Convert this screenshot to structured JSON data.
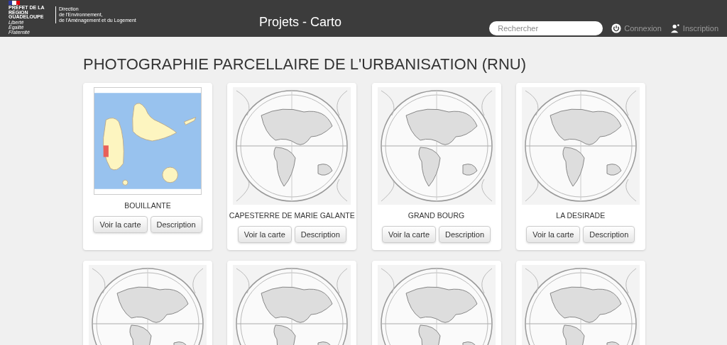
{
  "header": {
    "logo": {
      "name": "PRÉFET DE LA RÉGION GUADELOUPE",
      "motto": "Liberté Égalité Fraternité",
      "department": [
        "Direction",
        "de l'Environnement,",
        "de l'Aménagement et du Logement"
      ]
    },
    "title": "Projets - Carto",
    "search": {
      "placeholder": "Rechercher"
    },
    "links": [
      {
        "kind": "power",
        "label": "Connexion"
      },
      {
        "kind": "user",
        "label": "Inscription"
      }
    ]
  },
  "heading": "PHOTOGRAPHIE PARCELLAIRE DE L'URBANISATION (RNU)",
  "cards": [
    {
      "kind": "island-map",
      "title": "BOUILLANTE",
      "buttons": [
        "Voir la carte",
        "Description"
      ]
    },
    {
      "kind": "world-map",
      "title": "CAPESTERRE DE MARIE GALANTE",
      "buttons": [
        "Voir la carte",
        "Description"
      ]
    },
    {
      "kind": "world-map",
      "title": "GRAND BOURG",
      "buttons": [
        "Voir la carte",
        "Description"
      ]
    },
    {
      "kind": "world-map",
      "title": "LA DESIRADE",
      "buttons": [
        "Voir la carte",
        "Description"
      ]
    },
    {
      "kind": "world-map"
    },
    {
      "kind": "world-map"
    },
    {
      "kind": "world-map"
    },
    {
      "kind": "world-map"
    }
  ]
}
